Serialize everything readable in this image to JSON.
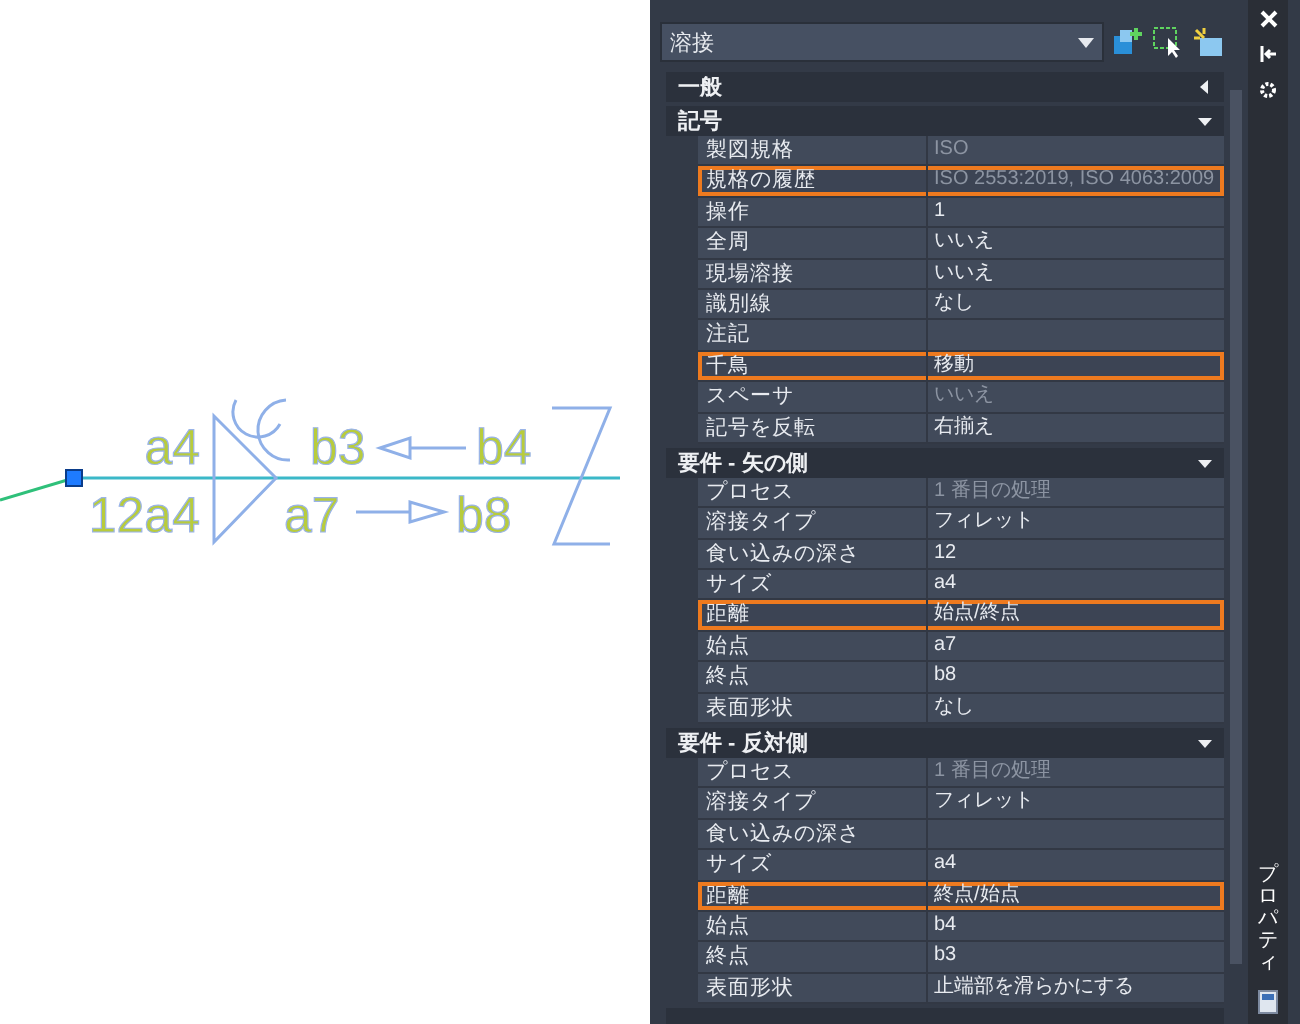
{
  "drawing": {
    "labels": [
      "a4",
      "b3",
      "b4",
      "12a4",
      "a7",
      "b8"
    ]
  },
  "palette": {
    "selector": {
      "value": "溶接"
    },
    "sections": [
      {
        "title": "一般",
        "expanded": false
      },
      {
        "title": "記号",
        "expanded": true,
        "rows": [
          {
            "label": "製図規格",
            "value": "ISO",
            "disabled": true,
            "highlighted": false
          },
          {
            "label": "規格の履歴",
            "value": "ISO 2553:2019, ISO 4063:2009",
            "disabled": true,
            "highlighted": true
          },
          {
            "label": "操作",
            "value": "1",
            "disabled": false,
            "highlighted": false
          },
          {
            "label": "全周",
            "value": "いいえ",
            "disabled": false,
            "highlighted": false
          },
          {
            "label": "現場溶接",
            "value": "いいえ",
            "disabled": false,
            "highlighted": false
          },
          {
            "label": "識別線",
            "value": "なし",
            "disabled": false,
            "highlighted": false
          },
          {
            "label": "注記",
            "highlighted": false
          },
          {
            "label": "千鳥",
            "value": "移動",
            "disabled": false,
            "highlighted": true
          },
          {
            "label": "スペーサ",
            "value": "いいえ",
            "disabled": true,
            "highlighted": false
          },
          {
            "label": "記号を反転",
            "value": "右揃え",
            "disabled": false,
            "highlighted": false
          }
        ]
      },
      {
        "title": "要件 - 矢の側",
        "expanded": true,
        "rows": [
          {
            "label": "プロセス",
            "value": "1 番目の処理",
            "disabled": true,
            "highlighted": false
          },
          {
            "label": "溶接タイプ",
            "value": "フィレット",
            "disabled": false,
            "highlighted": false
          },
          {
            "label": "食い込みの深さ",
            "value": "12",
            "disabled": false,
            "highlighted": false
          },
          {
            "label": "サイズ",
            "value": "a4",
            "disabled": false,
            "highlighted": false
          },
          {
            "label": "距離",
            "value": "始点/終点",
            "disabled": false,
            "highlighted": true
          },
          {
            "label": "始点",
            "value": "a7",
            "disabled": false,
            "highlighted": false
          },
          {
            "label": "終点",
            "value": "b8",
            "disabled": false,
            "highlighted": false
          },
          {
            "label": "表面形状",
            "value": "なし",
            "disabled": false,
            "highlighted": false
          }
        ]
      },
      {
        "title": "要件 - 反対側",
        "expanded": true,
        "rows": [
          {
            "label": "プロセス",
            "value": "1 番目の処理",
            "disabled": true,
            "highlighted": false
          },
          {
            "label": "溶接タイプ",
            "value": "フィレット",
            "disabled": false,
            "highlighted": false
          },
          {
            "label": "食い込みの深さ",
            "highlighted": false
          },
          {
            "label": "サイズ",
            "value": "a4",
            "disabled": false,
            "highlighted": false
          },
          {
            "label": "距離",
            "value": "終点/始点",
            "disabled": false,
            "highlighted": true
          },
          {
            "label": "始点",
            "value": "b4",
            "disabled": false,
            "highlighted": false
          },
          {
            "label": "終点",
            "value": "b3",
            "disabled": false,
            "highlighted": false
          },
          {
            "label": "表面形状",
            "value": "止端部を滑らかにする",
            "disabled": false,
            "highlighted": false
          }
        ]
      }
    ],
    "side_title": "プロパティ"
  }
}
